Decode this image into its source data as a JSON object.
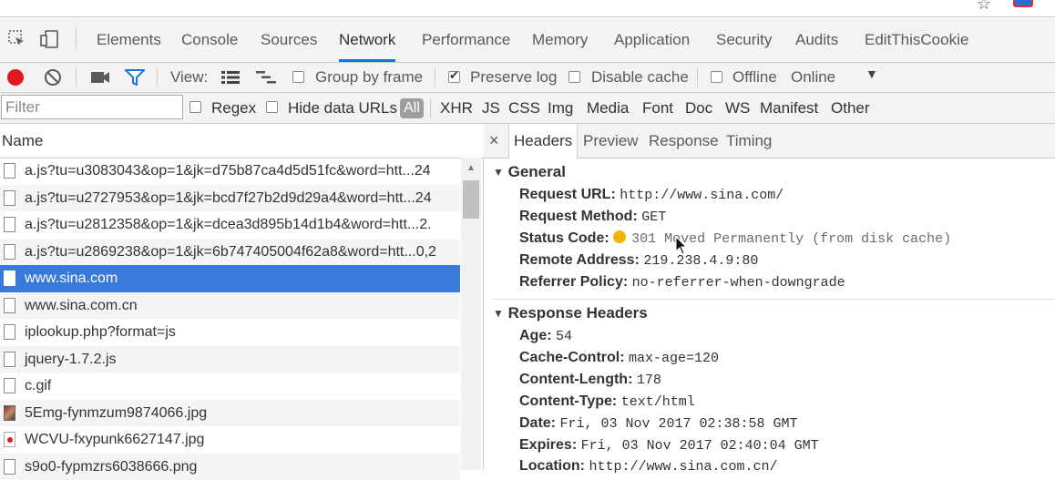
{
  "devtools": {
    "tabs": [
      "Elements",
      "Console",
      "Sources",
      "Network",
      "Performance",
      "Memory",
      "Application",
      "Security",
      "Audits",
      "EditThisCookie"
    ],
    "active_tab": "Network",
    "toolbar": {
      "view_label": "View:",
      "group_by_frame": "Group by frame",
      "preserve_log": "Preserve log",
      "disable_cache": "Disable cache",
      "offline": "Offline",
      "throttle": "Online"
    },
    "filterbar": {
      "filter_placeholder": "Filter",
      "regex": "Regex",
      "hide_data_urls": "Hide data URLs",
      "all": "All",
      "types": [
        "XHR",
        "JS",
        "CSS",
        "Img",
        "Media",
        "Font",
        "Doc",
        "WS",
        "Manifest",
        "Other"
      ]
    },
    "list": {
      "header": "Name",
      "rows": [
        "a.js?tu=u3083043&op=1&jk=d75b87ca4d5d51fc&word=htt...24",
        "a.js?tu=u2727953&op=1&jk=bcd7f27b2d9d29a4&word=htt...24",
        "a.js?tu=u2812358&op=1&jk=dcea3d895b14d1b4&word=htt...2.",
        "a.js?tu=u2869238&op=1&jk=6b747405004f62a8&word=htt...0,2",
        "www.sina.com",
        "www.sina.com.cn",
        "iplookup.php?format=js",
        "jquery-1.7.2.js",
        "c.gif",
        "5Emg-fynmzum9874066.jpg",
        "WCVU-fxypunk6627147.jpg",
        "s9o0-fypmzrs6038666.png"
      ],
      "selected_index": 4
    },
    "detail": {
      "close": "×",
      "subtabs": [
        "Headers",
        "Preview",
        "Response",
        "Timing"
      ],
      "active_subtab": "Headers",
      "general_title": "General",
      "general": [
        {
          "k": "Request URL:",
          "v": "http://www.sina.com/"
        },
        {
          "k": "Request Method:",
          "v": "GET"
        },
        {
          "k": "Status Code:",
          "v": "301 Moved Permanently (from disk cache)"
        },
        {
          "k": "Remote Address:",
          "v": "219.238.4.9:80"
        },
        {
          "k": "Referrer Policy:",
          "v": "no-referrer-when-downgrade"
        }
      ],
      "response_title": "Response Headers",
      "response": [
        {
          "k": "Age:",
          "v": "54"
        },
        {
          "k": "Cache-Control:",
          "v": "max-age=120"
        },
        {
          "k": "Content-Length:",
          "v": "178"
        },
        {
          "k": "Content-Type:",
          "v": "text/html"
        },
        {
          "k": "Date:",
          "v": "Fri, 03 Nov 2017 02:38:58 GMT"
        },
        {
          "k": "Expires:",
          "v": "Fri, 03 Nov 2017 02:40:04 GMT"
        },
        {
          "k": "Location:",
          "v": "http://www.sina.com.cn/"
        }
      ]
    },
    "colors": {
      "accent": "#1a73e8",
      "selected_row": "#3879d9",
      "record": "#e0191d",
      "status_dot": "#f4b400"
    }
  }
}
